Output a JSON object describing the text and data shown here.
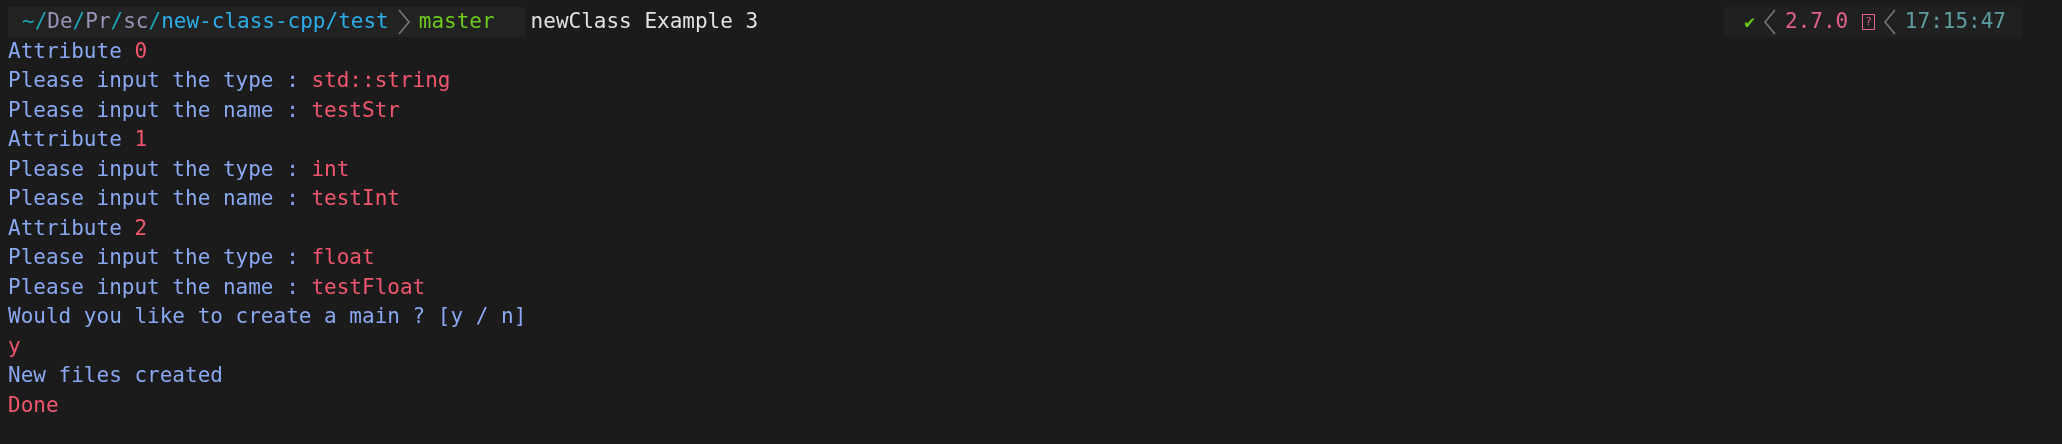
{
  "prompt": {
    "path": [
      {
        "text": "~/",
        "kind": "sep"
      },
      {
        "text": "De",
        "kind": "dir"
      },
      {
        "text": "/",
        "kind": "sep"
      },
      {
        "text": "Pr",
        "kind": "dir"
      },
      {
        "text": "/",
        "kind": "sep"
      },
      {
        "text": "sc",
        "kind": "dir"
      },
      {
        "text": "/",
        "kind": "sep"
      },
      {
        "text": "new-class-cpp/test",
        "kind": "current"
      }
    ],
    "branch": "master",
    "command": "newClass Example 3"
  },
  "right_prompt": {
    "status": "✔",
    "version": "2.7.0",
    "glyph": "?",
    "time": "17:15:47"
  },
  "output": [
    [
      {
        "text": "Attribute ",
        "kind": "text"
      },
      {
        "text": "0",
        "kind": "input"
      }
    ],
    [
      {
        "text": "Please input the type : ",
        "kind": "text"
      },
      {
        "text": "std::string",
        "kind": "input"
      }
    ],
    [
      {
        "text": "Please input the name : ",
        "kind": "text"
      },
      {
        "text": "testStr",
        "kind": "input"
      }
    ],
    [
      {
        "text": "Attribute ",
        "kind": "text"
      },
      {
        "text": "1",
        "kind": "input"
      }
    ],
    [
      {
        "text": "Please input the type : ",
        "kind": "text"
      },
      {
        "text": "int",
        "kind": "input"
      }
    ],
    [
      {
        "text": "Please input the name : ",
        "kind": "text"
      },
      {
        "text": "testInt",
        "kind": "input"
      }
    ],
    [
      {
        "text": "Attribute ",
        "kind": "text"
      },
      {
        "text": "2",
        "kind": "input"
      }
    ],
    [
      {
        "text": "Please input the type : ",
        "kind": "text"
      },
      {
        "text": "float",
        "kind": "input"
      }
    ],
    [
      {
        "text": "Please input the name : ",
        "kind": "text"
      },
      {
        "text": "testFloat",
        "kind": "input"
      }
    ],
    [
      {
        "text": "Would you like to create a main ? [y / n]",
        "kind": "text"
      }
    ],
    [
      {
        "text": "y",
        "kind": "input"
      }
    ],
    [
      {
        "text": "New files created",
        "kind": "text"
      }
    ],
    [
      {
        "text": "Done",
        "kind": "input"
      }
    ]
  ]
}
